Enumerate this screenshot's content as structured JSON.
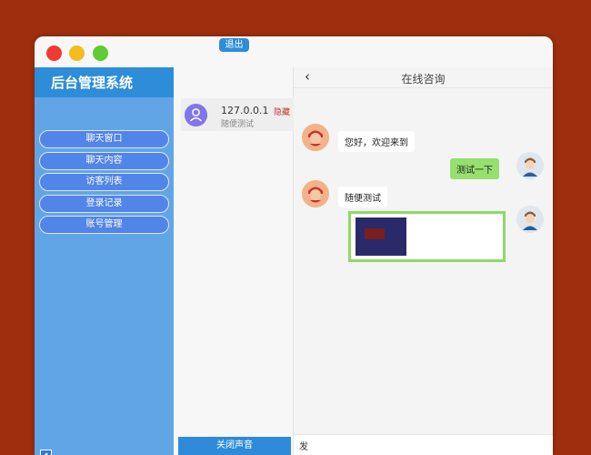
{
  "app": {
    "title": "后台管理系统",
    "logout_label": "退出"
  },
  "sidebar": {
    "items": [
      {
        "label": "聊天窗口"
      },
      {
        "label": "聊天内容"
      },
      {
        "label": "访客列表"
      },
      {
        "label": "登录记录"
      },
      {
        "label": "账号管理"
      }
    ],
    "collapse_icon": "◂"
  },
  "visitors": {
    "items": [
      {
        "ip": "127.0.0.1",
        "tag": "隐藏",
        "last_message": "随便测试"
      }
    ],
    "mute_label": "关闭声音"
  },
  "chat": {
    "title": "在线咨询",
    "back_icon": "‹",
    "messages": [
      {
        "from": "agent",
        "text": "您好，欢迎来到"
      },
      {
        "from": "user",
        "text": "测试一下"
      },
      {
        "from": "agent",
        "text": "随便测试"
      }
    ],
    "input_value": "发"
  },
  "colors": {
    "background": "#9e2e0e",
    "sidebar": "#62a5e6",
    "header": "#2e8dd9",
    "user_bubble": "#95e06f"
  }
}
